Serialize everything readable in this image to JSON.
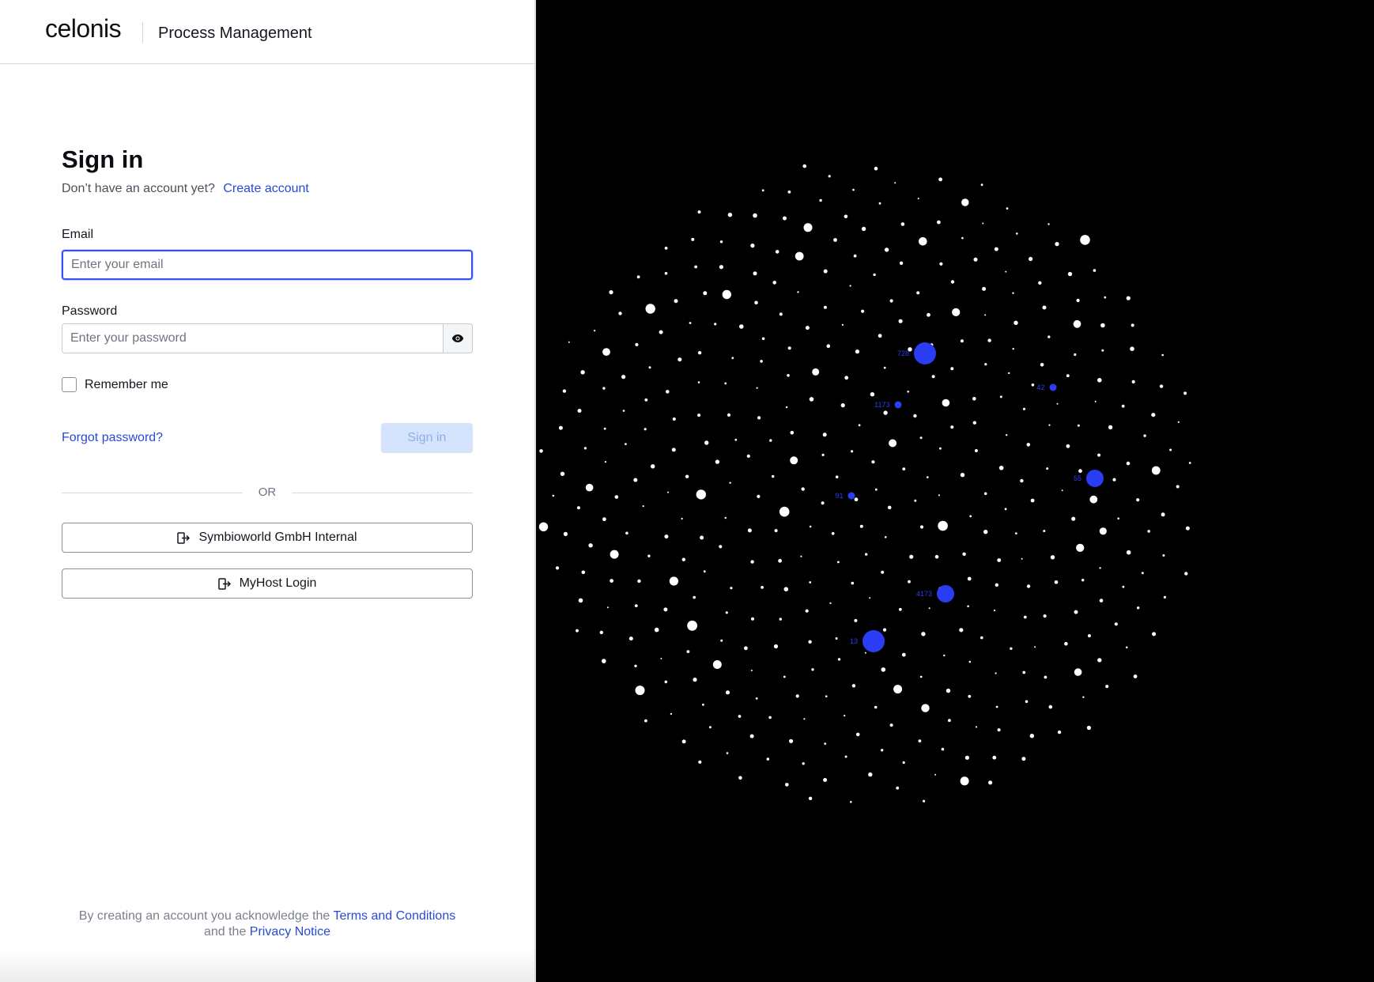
{
  "header": {
    "logo": "celonis",
    "product": "Process Management"
  },
  "signin": {
    "title": "Sign in",
    "no_account_text": "Don’t have an account yet?",
    "create_account_link": "Create account",
    "email_label": "Email",
    "email_placeholder": "Enter your email",
    "password_label": "Password",
    "password_placeholder": "Enter your password",
    "remember_me_label": "Remember me",
    "forgot_password_link": "Forgot password?",
    "signin_button": "Sign in",
    "or_divider": "OR",
    "sso_buttons": [
      "Symbioworld GmbH Internal",
      "MyHost Login"
    ]
  },
  "footer": {
    "text_before": "By creating an account you acknowledge the",
    "terms_link": "Terms and Conditions",
    "text_middle": "and the",
    "privacy_link": "Privacy Notice"
  },
  "visual": {
    "background_color": "#000000",
    "dot_color": "#ffffff",
    "highlight_color": "#2b3cf5",
    "highlight_labels": [
      "728",
      "42",
      "1173",
      "55",
      "91",
      "4173",
      "13"
    ]
  },
  "colors": {
    "accent": "#2749d8",
    "focus_border": "#3552f0",
    "disabled_button_bg": "#d5e4fc"
  }
}
